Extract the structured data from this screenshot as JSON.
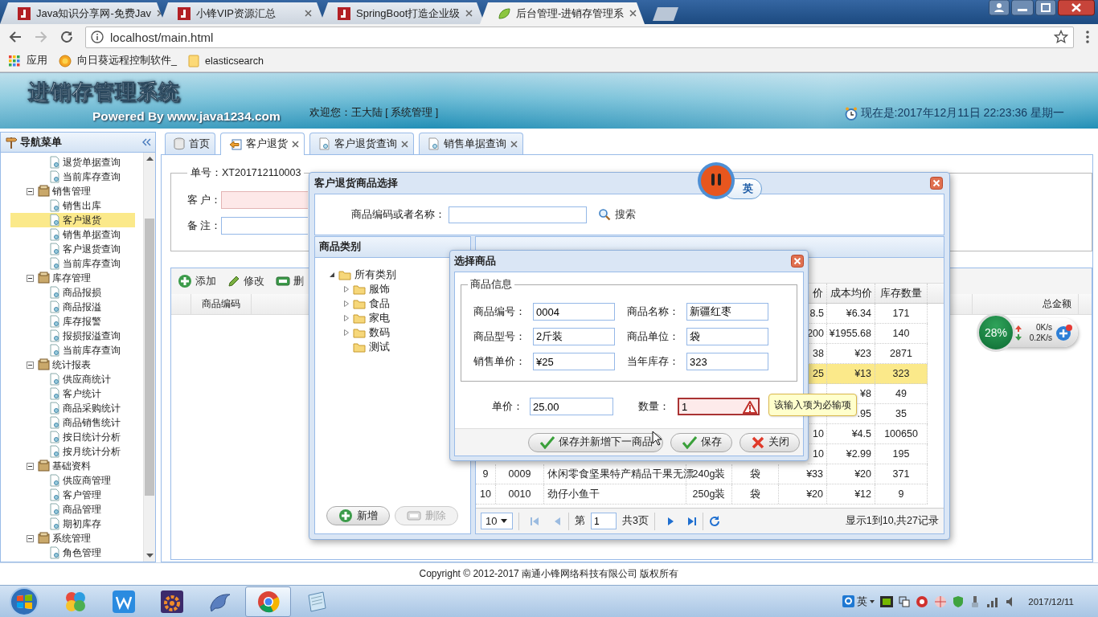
{
  "browser": {
    "tabs": [
      {
        "title": "Java知识分享网-免费Jav",
        "kind": "site",
        "selected": false
      },
      {
        "title": "小锋VIP资源汇总",
        "kind": "site",
        "selected": false
      },
      {
        "title": "SpringBoot打造企业级",
        "kind": "site",
        "selected": false
      },
      {
        "title": "后台管理-进销存管理系",
        "kind": "app",
        "selected": true
      }
    ],
    "address": "localhost/main.html",
    "bookmarks": [
      {
        "label": "应用",
        "kind": "apps"
      },
      {
        "label": "向日葵远程控制软件_",
        "kind": "site"
      },
      {
        "label": "elasticsearch",
        "kind": "folder"
      }
    ]
  },
  "header": {
    "title": "进销存管理系统",
    "subtitle": "Powered By www.java1234.com",
    "welcome": "欢迎您：王大陆 [ 系统管理 ]",
    "clock": "现在是:2017年12月11日 22:23:36 星期一"
  },
  "nav": {
    "title": "导航菜单",
    "tree": [
      {
        "children": [
          {
            "label": "退货单据查询",
            "selected": false
          },
          {
            "label": "当前库存查询",
            "selected": false
          }
        ]
      },
      {
        "label": "销售管理",
        "expanded": true,
        "children": [
          {
            "label": "销售出库",
            "selected": false
          },
          {
            "label": "客户退货",
            "selected": true
          },
          {
            "label": "销售单据查询",
            "selected": false
          },
          {
            "label": "客户退货查询",
            "selected": false
          },
          {
            "label": "当前库存查询",
            "selected": false
          }
        ]
      },
      {
        "label": "库存管理",
        "expanded": true,
        "children": [
          {
            "label": "商品报损",
            "selected": false
          },
          {
            "label": "商品报溢",
            "selected": false
          },
          {
            "label": "库存报警",
            "selected": false
          },
          {
            "label": "报损报溢查询",
            "selected": false
          },
          {
            "label": "当前库存查询",
            "selected": false
          }
        ]
      },
      {
        "label": "统计报表",
        "expanded": true,
        "children": [
          {
            "label": "供应商统计",
            "selected": false
          },
          {
            "label": "客户统计",
            "selected": false
          },
          {
            "label": "商品采购统计",
            "selected": false
          },
          {
            "label": "商品销售统计",
            "selected": false
          },
          {
            "label": "按日统计分析",
            "selected": false
          },
          {
            "label": "按月统计分析",
            "selected": false
          }
        ]
      },
      {
        "label": "基础资料",
        "expanded": true,
        "children": [
          {
            "label": "供应商管理",
            "selected": false
          },
          {
            "label": "客户管理",
            "selected": false
          },
          {
            "label": "商品管理",
            "selected": false
          },
          {
            "label": "期初库存",
            "selected": false
          }
        ]
      },
      {
        "label": "系统管理",
        "expanded": true,
        "children": [
          {
            "label": "角色管理",
            "selected": false
          }
        ]
      }
    ]
  },
  "tabs": [
    {
      "label": "首页",
      "kind": "home",
      "selected": false,
      "closable": false
    },
    {
      "label": "客户退货",
      "kind": "return",
      "selected": true,
      "closable": true
    },
    {
      "label": "客户退货查询",
      "kind": "query",
      "selected": false,
      "closable": true
    },
    {
      "label": "销售单据查询",
      "kind": "query",
      "selected": false,
      "closable": true
    }
  ],
  "order": {
    "number": "单号：XT201712110003",
    "fields": [
      {
        "label": "客 户：",
        "invalid": true
      },
      {
        "label": "备 注：",
        "invalid": false
      }
    ],
    "toolbar": [
      {
        "label": "添加",
        "kind": "add"
      },
      {
        "label": "修改",
        "kind": "edit"
      },
      {
        "label": "删",
        "kind": "delete"
      }
    ],
    "columns": {
      "code": "商品编码",
      "total": "总金额"
    }
  },
  "return_dialog": {
    "title": "客户退货商品选择",
    "search_label": "商品编码或者名称：",
    "search_button": "搜索",
    "categories": {
      "title": "商品类别",
      "tree": [
        {
          "label": "所有类别",
          "expanded": true,
          "children": [
            {
              "label": "服饰",
              "kind": "branch",
              "expanded": false
            },
            {
              "label": "食品",
              "kind": "branch",
              "expanded": false
            },
            {
              "label": "家电",
              "kind": "branch",
              "expanded": false
            },
            {
              "label": "数码",
              "kind": "branch",
              "expanded": false
            },
            {
              "label": "测试",
              "kind": "leaf"
            }
          ]
        }
      ],
      "buttons": [
        {
          "label": "新增",
          "kind": "add",
          "disabled": false
        },
        {
          "label": "删除",
          "kind": "delete",
          "disabled": true
        }
      ]
    },
    "products": {
      "columns": [
        {
          "label": "价"
        },
        {
          "label": "成本均价"
        },
        {
          "label": "库存数量"
        }
      ],
      "rows": [
        {
          "price": "8.5",
          "cost": "¥6.34",
          "stock": "171",
          "selected": false
        },
        {
          "price": "200",
          "cost": "¥1955.68",
          "stock": "140",
          "selected": false
        },
        {
          "price": "38",
          "cost": "¥23",
          "stock": "2871",
          "selected": false
        },
        {
          "price": "25",
          "cost": "¥13",
          "stock": "323",
          "selected": true
        },
        {
          "cost": "¥8",
          "stock": "49",
          "selected": false
        },
        {
          "cost": ".95",
          "stock": "35",
          "selected": false
        },
        {
          "price": "10",
          "cost": "¥4.5",
          "stock": "100650",
          "selected": false
        },
        {
          "price": "10",
          "cost": "¥2.99",
          "stock": "195",
          "selected": false
        },
        {
          "num": "9",
          "code": "0009",
          "name": "休闲零食坚果特产精品干果无漂",
          "model": "240g装",
          "unit": "袋",
          "price": "¥33",
          "cost": "¥20",
          "stock": "371",
          "selected": false
        },
        {
          "num": "10",
          "code": "0010",
          "name": "劲仔小鱼干",
          "model": "250g装",
          "unit": "袋",
          "price": "¥20",
          "cost": "¥12",
          "stock": "9",
          "selected": false
        }
      ],
      "pager": {
        "page_size": "10",
        "page_prefix": "第",
        "page": "1",
        "page_total": "共3页",
        "summary": "显示1到10,共27记录"
      }
    }
  },
  "pick_dialog": {
    "title": "选择商品",
    "legend": "商品信息",
    "info": [
      {
        "label": "商品编号：",
        "value": "0004"
      },
      {
        "label": "商品名称：",
        "value": "新疆红枣"
      },
      {
        "label": "商品型号：",
        "value": "2斤装"
      },
      {
        "label": "商品单位：",
        "value": "袋"
      },
      {
        "label": "销售单价：",
        "value": "¥25"
      },
      {
        "label": "当年库存：",
        "value": "323"
      }
    ],
    "price": {
      "label": "单价：",
      "value": "25.00"
    },
    "quantity": {
      "label": "数量：",
      "value": "1",
      "invalid": true
    },
    "tooltip": "该输入项为必输项",
    "buttons": [
      {
        "label": "保存并新增下一商品",
        "kind": "save"
      },
      {
        "label": "保存",
        "kind": "save"
      },
      {
        "label": "关闭",
        "kind": "close"
      }
    ]
  },
  "ime": {
    "label": "英"
  },
  "net_monitor": {
    "percent": "28%",
    "up": "0K/s",
    "down": "0.2K/s"
  },
  "footer": {
    "copyright": "Copyright © 2012-2017 南通小锋网络科技有限公司 版权所有"
  },
  "taskbar": {
    "apps": [
      {
        "kind": "pinwheel",
        "active": false
      },
      {
        "kind": "writer",
        "active": false
      },
      {
        "kind": "ide",
        "active": false
      },
      {
        "kind": "dolphin",
        "active": false
      },
      {
        "kind": "browser",
        "active": true
      },
      {
        "kind": "notepad",
        "active": false
      }
    ],
    "ime": "英",
    "date": "2017/12/11"
  }
}
